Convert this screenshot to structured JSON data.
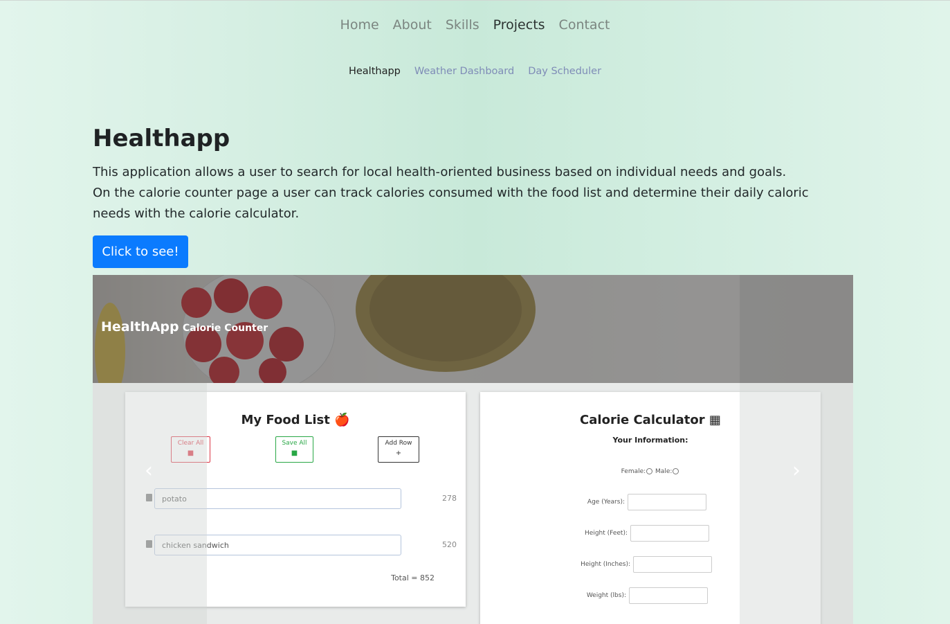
{
  "nav": {
    "items": [
      {
        "label": "Home"
      },
      {
        "label": "About"
      },
      {
        "label": "Skills"
      },
      {
        "label": "Projects",
        "active": true
      },
      {
        "label": "Contact"
      }
    ]
  },
  "subnav": {
    "items": [
      {
        "label": "Healthapp",
        "active": true
      },
      {
        "label": "Weather Dashboard"
      },
      {
        "label": "Day Scheduler"
      }
    ]
  },
  "project": {
    "title": "Healthapp",
    "desc1": "This application allows a user to search for local health-oriented business based on individual needs and goals.",
    "desc2": "On the calorie counter page a user can track calories consumed with the food list and determine their daily caloric needs with the calorie calculator.",
    "button": "Click to see!"
  },
  "screenshot": {
    "brand": "HealthApp",
    "link": "Calorie Counter",
    "food": {
      "title": "My Food List",
      "clear": "Clear All",
      "save": "Save All",
      "add": "Add Row",
      "rows": [
        {
          "food": "potato",
          "cal": "278"
        },
        {
          "food": "chicken sandwich",
          "cal": "520"
        }
      ],
      "total": "Total = 852"
    },
    "calc": {
      "title": "Calorie Calculator",
      "sub": "Your Information:",
      "female": "Female:",
      "male": "Male:",
      "age": "Age (Years):",
      "heightFeet": "Height (Feet):",
      "heightInches": "Height (Inches):",
      "weight": "Weight (lbs):"
    }
  },
  "colors": {
    "accent": "#0b7bfe",
    "clear": "#dc3545",
    "save": "#28a745"
  }
}
